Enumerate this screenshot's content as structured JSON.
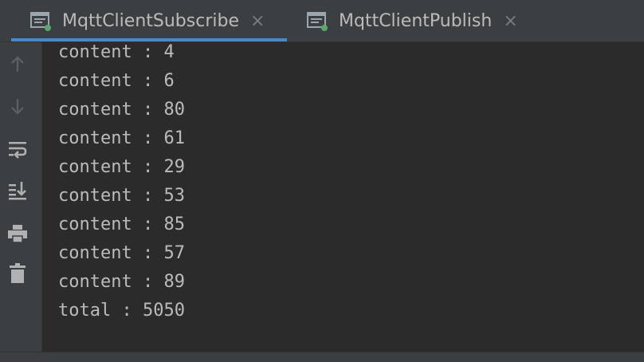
{
  "tabs": [
    {
      "label": "MqttClientSubscribe",
      "icon": "run-console-icon",
      "active": true,
      "close_glyph": "×"
    },
    {
      "label": "MqttClientPublish",
      "icon": "run-console-icon",
      "active": false,
      "close_glyph": "×"
    }
  ],
  "toolbar": {
    "items": [
      {
        "icon": "arrow-up-icon"
      },
      {
        "icon": "arrow-down-icon"
      },
      {
        "icon": "soft-wrap-icon"
      },
      {
        "icon": "scroll-to-end-icon"
      },
      {
        "icon": "print-icon"
      },
      {
        "icon": "trash-icon"
      }
    ]
  },
  "console": {
    "lines": [
      "content : 4",
      "content : 6",
      "content : 80",
      "content : 61",
      "content : 29",
      "content : 53",
      "content : 85",
      "content : 57",
      "content : 89",
      "total : 5050"
    ]
  },
  "colors": {
    "background": "#2b2b2b",
    "panel": "#3c3f41",
    "text": "#bbbbbb",
    "accent": "#4a88c7",
    "run_indicator": "#59a869"
  }
}
